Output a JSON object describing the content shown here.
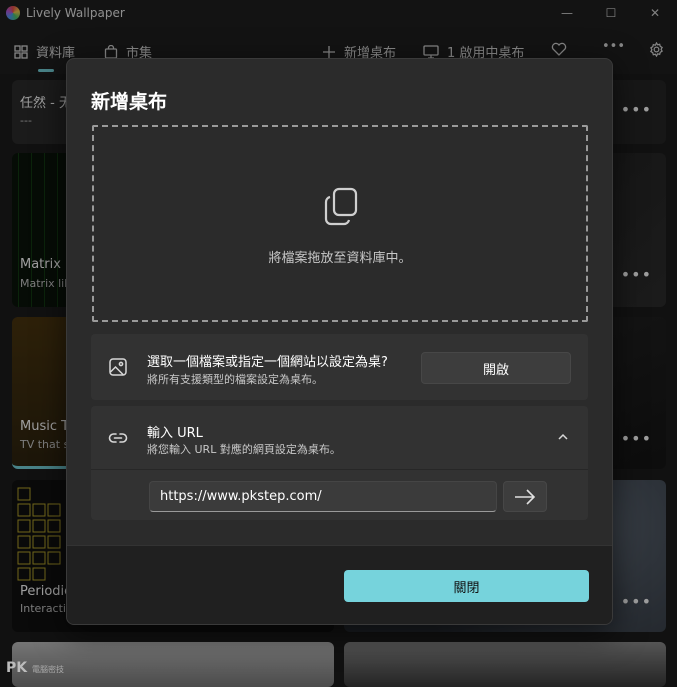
{
  "window": {
    "title": "Lively Wallpaper",
    "minimize_glyph": "—",
    "maximize_glyph": "☐",
    "close_glyph": "✕"
  },
  "nav": {
    "library": "資料庫",
    "gallery": "市集",
    "add_wallpaper": "新增桌布",
    "active_wallpapers": "1 啟用中桌布",
    "more": "•••"
  },
  "tiles": [
    {
      "title": "任然 - 无",
      "subtitle": "---"
    },
    {
      "title": "Matrix R",
      "subtitle": "Matrix lik"
    },
    {
      "title": "Music T",
      "subtitle": "TV that s"
    },
    {
      "title": "Periodic",
      "subtitle": "Interactiv"
    }
  ],
  "tile_menu": "•••",
  "dialog": {
    "title": "新增桌布",
    "drop_text": "將檔案拖放至資料庫中。",
    "choose_file": {
      "heading": "選取一個檔案或指定一個網站以設定為桌?",
      "subtext": "將所有支援類型的檔案設定為桌布。",
      "button": "開啟"
    },
    "url": {
      "heading": "輸入 URL",
      "subtext": "將您輸入 URL 對應的網頁設定為桌布。",
      "value": "https://www.pkstep.com/"
    },
    "close_button": "關閉"
  },
  "watermark": {
    "main": "PK",
    "small": "電腦密技"
  },
  "colors": {
    "accent": "#76d3dc",
    "dialog_bg": "#2b2b2b",
    "card_bg": "#323232",
    "footer_bg": "#202020"
  }
}
